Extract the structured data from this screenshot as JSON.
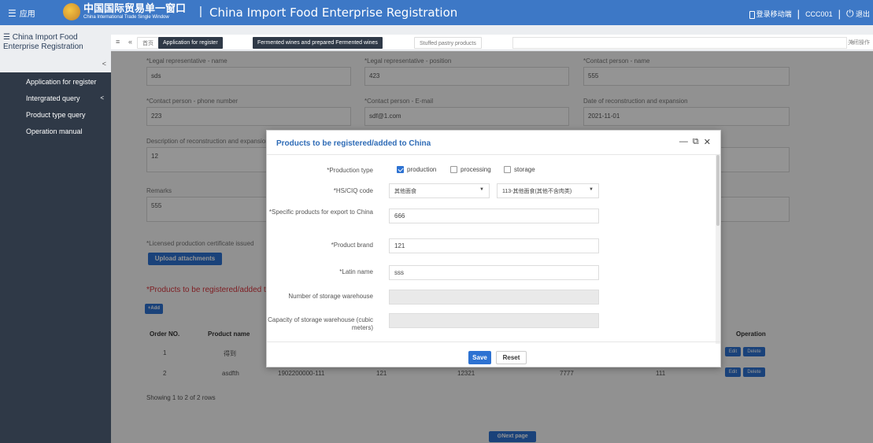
{
  "topbar": {
    "apps_label": "应用",
    "brand_cn": "中国国际贸易单一窗口",
    "brand_en": "China International Trade Single Window",
    "separator": "|",
    "title": "China Import Food Enterprise Registration",
    "mobile_label": "登录移动端",
    "user": "CCC001",
    "logout_label": "退出"
  },
  "sidebar": {
    "title": "China Import Food Enterprise Registration",
    "collapse": "<",
    "items": [
      {
        "label": "Application for register"
      },
      {
        "label": "Intergrated query",
        "arrow": "<"
      },
      {
        "label": "Product type query"
      },
      {
        "label": "Operation manual"
      }
    ]
  },
  "tabs": {
    "home": "首页",
    "items": [
      {
        "label": "Application for register"
      },
      {
        "label": "Fermented wines and prepared Fermented wines"
      },
      {
        "label": "Stuffed pastry products"
      }
    ],
    "close_ops": "关闭操作"
  },
  "form": {
    "legal_name_label": "*Legal representative - name",
    "legal_name_value": "sds",
    "legal_position_label": "*Legal representative - position",
    "legal_position_value": "423",
    "contact_name_label": "*Contact person - name",
    "contact_name_value": "555",
    "contact_phone_label": "*Contact person - phone number",
    "contact_phone_value": "223",
    "contact_email_label": "*Contact person - E-mail",
    "contact_email_value": "sdf@1.com",
    "date_label": "Date of reconstruction and expansion",
    "date_value": "2021-11-01",
    "desc_label": "Description of reconstruction and expansion",
    "desc_value": "12",
    "remarks_label": "Remarks",
    "remarks_value": "555",
    "cert_label": "*Licensed production certificate issued",
    "upload_label": "Upload attachments",
    "products_title": "*Products to be registered/added to China",
    "add_label": "+Add",
    "table_headers": [
      "Order NO.",
      "Product name",
      "Operation"
    ],
    "rows": [
      {
        "no": "1",
        "name": "得到",
        "edit": "Edit",
        "delete": "Delete"
      },
      {
        "no": "2",
        "name": "asdfth",
        "hs": "1902200000-111",
        "c1": "121",
        "c2": "12321",
        "c3": "7777",
        "c4": "111",
        "edit": "Edit",
        "delete": "Delete"
      }
    ],
    "showing": "Showing 1 to 2 of 2 rows",
    "next_label": "Next page"
  },
  "modal": {
    "title": "Products to be registered/added to China",
    "production_type_label": "*Production type",
    "opt_production": "production",
    "opt_processing": "processing",
    "opt_storage": "storage",
    "hs_label": "*HS/CIQ code",
    "hs_value1": "其他面食",
    "hs_value2": "113-其他面食(其他不含肉类)",
    "specific_label": "*Specific products for export to China",
    "specific_value": "666",
    "brand_label": "*Product brand",
    "brand_value": "121",
    "latin_label": "*Latin name",
    "latin_value": "sss",
    "storage_num_label": "Number of storage warehouse",
    "storage_cap_label": "Capacity of storage warehouse (cubic meters)",
    "save_label": "Save",
    "reset_label": "Reset"
  },
  "colors": {
    "header_blue": "#3d78c6",
    "sidebar_dark": "#2f3947",
    "accent_blue": "#2d72d2",
    "required_red": "#d9363e"
  }
}
